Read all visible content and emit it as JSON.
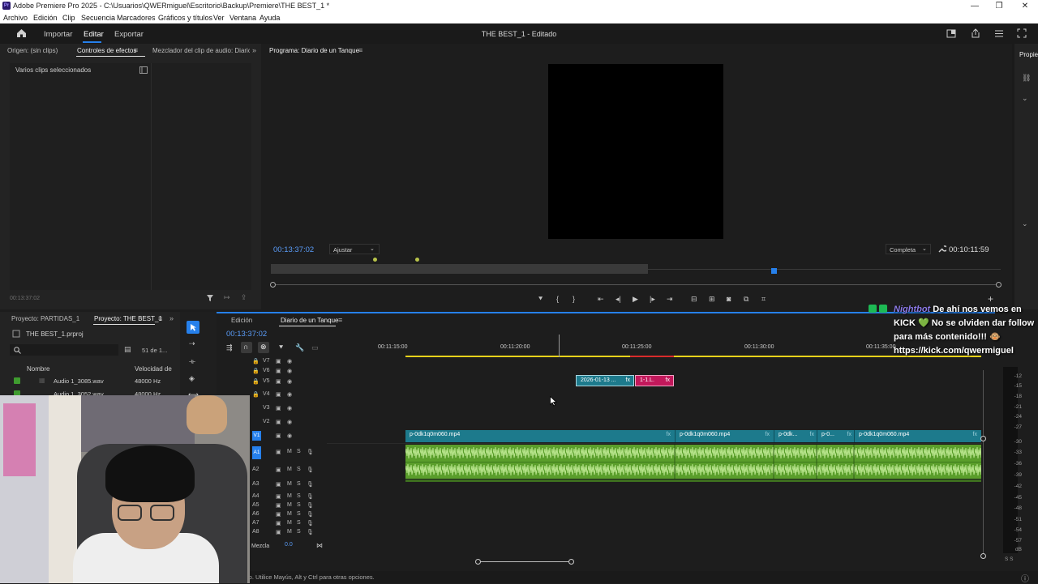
{
  "window": {
    "title": "Adobe Premiere Pro 2025 - C:\\Usuarios\\QWERmiguel\\Escritorio\\Backup\\Premiere\\THE BEST_1 *",
    "minimize": "—",
    "restore": "❐",
    "close": "✕"
  },
  "menu": [
    "Archivo",
    "Edición",
    "Clip",
    "Secuencia",
    "Marcadores",
    "Gráficos y títulos",
    "Ver",
    "Ventana",
    "Ayuda"
  ],
  "header": {
    "import": "Importar",
    "edit": "Editar",
    "export": "Exportar",
    "project_status": "THE BEST_1 - Editado"
  },
  "source_panel": {
    "tabs": [
      "Origen: (sin clips)",
      "Controles de efectos",
      "Mezclador del clip de audio: Diario de"
    ],
    "info": "Varios clips seleccionados",
    "timecode": "00:13:37:02"
  },
  "program_monitor": {
    "tab": "Programa: Diario de un Tanque",
    "timecode": "00:13:37:02",
    "fit": "Ajustar",
    "quality": "Completa",
    "duration": "00:10:11:59"
  },
  "right_panel": {
    "tab": "Propied"
  },
  "project_panel": {
    "tabs": [
      "Proyecto: PARTIDAS_1",
      "Proyecto: THE BEST_1"
    ],
    "file": "THE BEST_1.prproj",
    "count": "51 de 1...",
    "col_name": "Nombre",
    "col_rate": "Velocidad de",
    "items": [
      {
        "name": "Audio 1_3085.wav",
        "rate": "48000 Hz"
      },
      {
        "name": "Audio 1_3052.wav",
        "rate": "48000 Hz"
      }
    ]
  },
  "timeline": {
    "tabs": [
      "Edición",
      "Diario de un Tanque"
    ],
    "timecode": "00:13:37:02",
    "ruler": [
      "00:11:15:00",
      "00:11:20:00",
      "00:11:25:00",
      "00:11:30:00",
      "00:11:35:00"
    ],
    "video_tracks": [
      "V7",
      "V6",
      "V5",
      "V4",
      "V3",
      "V2",
      "V1"
    ],
    "audio_tracks": [
      "A1",
      "A2",
      "A3",
      "A4",
      "A5",
      "A6",
      "A7",
      "A8"
    ],
    "mix_label": "Mezcla",
    "mix_value": "0.0",
    "clips": {
      "v5a": "2026-01-13 ...",
      "v5b": "1-1.L.",
      "fx": "fx",
      "v1a": "p-0dk1q0m060.mp4",
      "v1b": "p-0dk1q0m060.mp4",
      "v1c": "p-0dk...",
      "v1d": "p-0...",
      "v1e": "p-0dk1q0m060.mp4"
    }
  },
  "meter": {
    "scale": [
      "-12",
      "-15",
      "-18",
      "-21",
      "-24",
      "-27",
      "-30",
      "-33",
      "-36",
      "-39",
      "-42",
      "-45",
      "-48",
      "-51",
      "-54",
      "-57",
      "dB"
    ],
    "solo": "S  S"
  },
  "status": "dro. Utilice Mayús, Alt y Ctrl para otras opciones.",
  "chat": {
    "user": "Nightbot",
    "message": "De ahí nos vemos en KICK 💚 No se olviden dar follow para más contenido!!! 🐵 https://kick.com/qwermiguel"
  },
  "colors": {
    "accent": "#2680eb",
    "video_clip": "#1d7a8c",
    "audio_clip": "#5a9e2b",
    "pink_clip": "#c2185b",
    "ruler_yellow": "#e8d21a",
    "ruler_red": "#d92b2b"
  }
}
